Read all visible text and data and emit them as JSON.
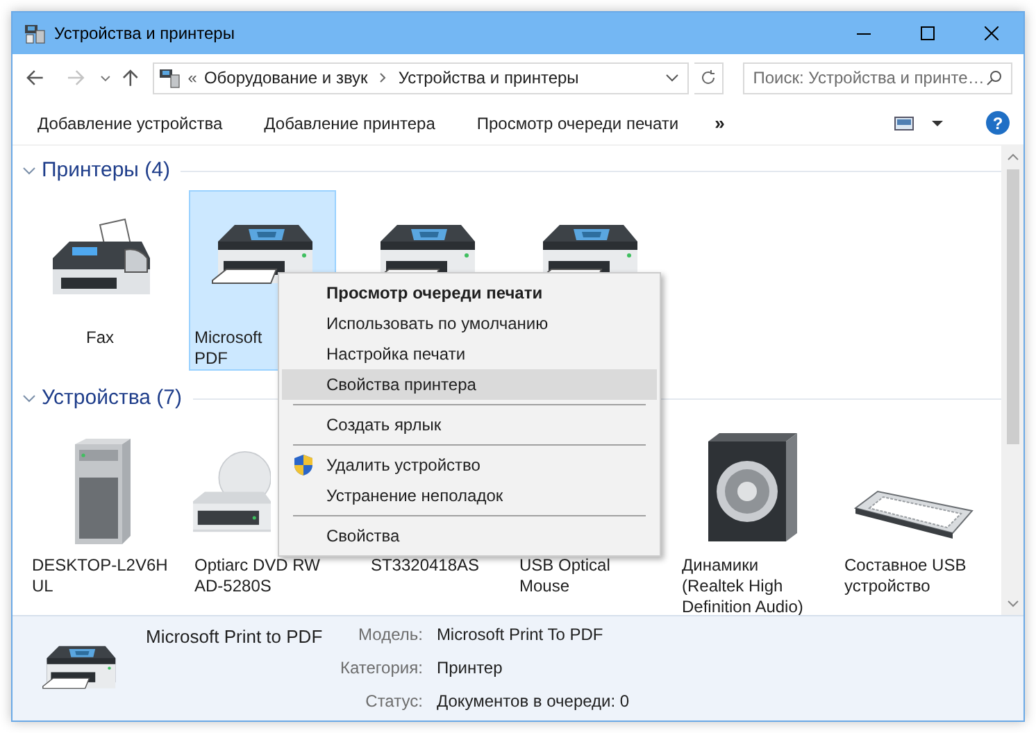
{
  "window": {
    "title": "Устройства и принтеры"
  },
  "address_bar": {
    "prefix": "«",
    "crumbs": [
      "Оборудование и звук",
      "Устройства и принтеры"
    ]
  },
  "search": {
    "placeholder": "Поиск: Устройства и принте…"
  },
  "command_bar": {
    "commands": [
      "Добавление устройства",
      "Добавление принтера",
      "Просмотр очереди печати"
    ],
    "more": "»",
    "help": "?"
  },
  "groups": [
    {
      "title": "Принтеры (4)",
      "expanded": true,
      "items": [
        {
          "kind": "fax",
          "lines": [
            "Fax"
          ],
          "selected": false
        },
        {
          "kind": "printer",
          "lines": [
            "Microsoft",
            "PDF"
          ],
          "selected": true
        },
        {
          "kind": "printer",
          "selected": false
        },
        {
          "kind": "printer",
          "selected": false
        }
      ]
    },
    {
      "title": "Устройства (7)",
      "expanded": true,
      "items": [
        {
          "kind": "computer",
          "lines": [
            "DESKTOP-L2V6H",
            "UL"
          ],
          "selected": false
        },
        {
          "kind": "optical_drive",
          "lines": [
            "Optiarc DVD RW",
            "AD-5280S"
          ],
          "selected": false
        },
        {
          "kind": "drive",
          "lines": [
            "ST3320418AS"
          ],
          "selected": false
        },
        {
          "kind": "mouse",
          "lines": [
            "USB Optical",
            "Mouse"
          ],
          "selected": false
        },
        {
          "kind": "speaker",
          "lines": [
            "Динамики",
            "(Realtek High",
            "Definition Audio)"
          ],
          "selected": false
        },
        {
          "kind": "keyboard",
          "lines": [
            "Составное USB",
            "устройство"
          ],
          "selected": false
        }
      ]
    }
  ],
  "context_menu": {
    "groups": [
      [
        {
          "label": "Просмотр очереди печати",
          "default": true,
          "selected": false,
          "elevated": false
        },
        {
          "label": "Использовать по умолчанию",
          "default": false,
          "selected": false,
          "elevated": false
        },
        {
          "label": "Настройка печати",
          "default": false,
          "selected": false,
          "elevated": false
        },
        {
          "label": "Свойства принтера",
          "default": false,
          "selected": true,
          "elevated": false
        }
      ],
      [
        {
          "label": "Создать ярлык",
          "default": false,
          "selected": false,
          "elevated": false
        }
      ],
      [
        {
          "label": "Удалить устройство",
          "default": false,
          "selected": false,
          "elevated": true
        },
        {
          "label": "Устранение неполадок",
          "default": false,
          "selected": false,
          "elevated": false
        }
      ],
      [
        {
          "label": "Свойства",
          "default": false,
          "selected": false,
          "elevated": false
        }
      ]
    ]
  },
  "details": {
    "name": "Microsoft Print to PDF",
    "fields": [
      {
        "label": "Модель:",
        "value": "Microsoft Print To PDF"
      },
      {
        "label": "Категория:",
        "value": "Принтер"
      },
      {
        "label": "Статус:",
        "value": "Документов в очереди: 0"
      }
    ]
  }
}
